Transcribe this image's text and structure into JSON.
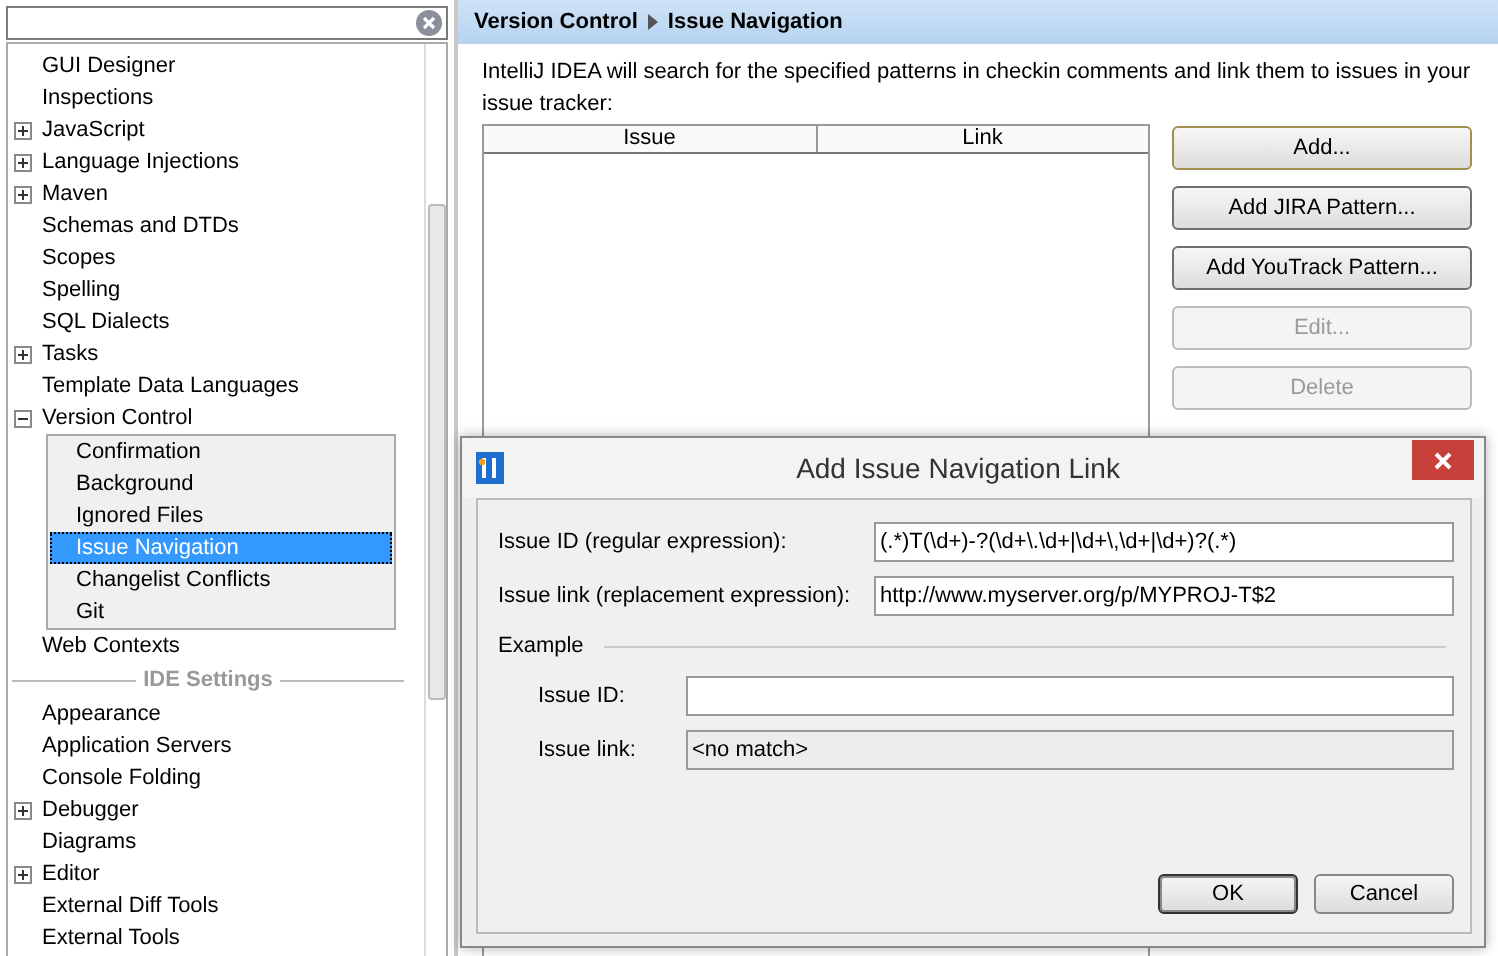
{
  "sidebar": {
    "project_items": [
      {
        "label": "GUI Designer"
      },
      {
        "label": "Inspections"
      },
      {
        "label": "JavaScript",
        "expanded": false
      },
      {
        "label": "Language Injections",
        "expanded": false
      },
      {
        "label": "Maven",
        "expanded": false
      },
      {
        "label": "Schemas and DTDs"
      },
      {
        "label": "Scopes"
      },
      {
        "label": "Spelling"
      },
      {
        "label": "SQL Dialects"
      },
      {
        "label": "Tasks",
        "expanded": false
      },
      {
        "label": "Template Data Languages"
      },
      {
        "label": "Version Control",
        "expanded": true,
        "children": [
          {
            "label": "Confirmation",
            "selected": false
          },
          {
            "label": "Background",
            "selected": false
          },
          {
            "label": "Ignored Files",
            "selected": false
          },
          {
            "label": "Issue Navigation",
            "selected": true
          },
          {
            "label": "Changelist Conflicts",
            "selected": false
          },
          {
            "label": "Git",
            "selected": false
          }
        ]
      },
      {
        "label": "Web Contexts"
      }
    ],
    "separator": "IDE Settings",
    "ide_items": [
      {
        "label": "Appearance"
      },
      {
        "label": "Application Servers"
      },
      {
        "label": "Console Folding"
      },
      {
        "label": "Debugger",
        "expanded": false
      },
      {
        "label": "Diagrams"
      },
      {
        "label": "Editor",
        "expanded": false
      },
      {
        "label": "External Diff Tools"
      },
      {
        "label": "External Tools"
      }
    ]
  },
  "breadcrumb": [
    "Version Control",
    "Issue Navigation"
  ],
  "description": "IntelliJ IDEA will search for the specified patterns in checkin comments and link them to issues in your issue tracker:",
  "table": {
    "columns": [
      "Issue",
      "Link"
    ]
  },
  "buttons": [
    {
      "label": "Add...",
      "disabled": false,
      "default": true
    },
    {
      "label": "Add JIRA Pattern...",
      "disabled": false,
      "default": false
    },
    {
      "label": "Add YouTrack Pattern...",
      "disabled": false,
      "default": false
    },
    {
      "label": "Edit...",
      "disabled": true,
      "default": false
    },
    {
      "label": "Delete",
      "disabled": true,
      "default": false
    }
  ],
  "dialog": {
    "title": "Add Issue Navigation Link",
    "fields": [
      {
        "label": "Issue ID (regular expression):",
        "value": "(.*)T(\\d+)-?(\\d+\\.\\d+|\\d+\\,\\d+|\\d+)?(.*)"
      },
      {
        "label": "Issue link (replacement expression):",
        "value": "http://www.myserver.org/p/MYPROJ-T$2"
      }
    ],
    "example": {
      "title": "Example",
      "fields": [
        {
          "label": "Issue ID:",
          "disabled": false
        },
        {
          "label": "Issue link:",
          "value": "<no match>",
          "disabled": true
        }
      ]
    },
    "buttons": [
      {
        "label": "OK",
        "default": true
      },
      {
        "label": "Cancel",
        "default": false
      }
    ]
  }
}
